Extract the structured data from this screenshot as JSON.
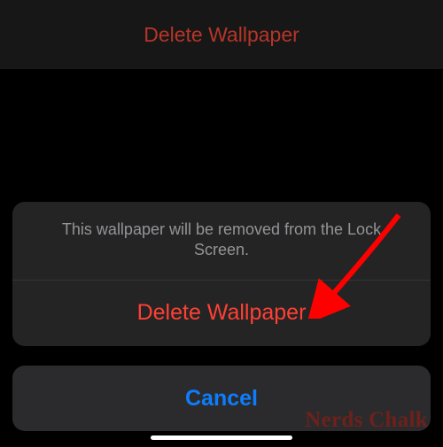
{
  "header": {
    "title": "Delete Wallpaper"
  },
  "actionSheet": {
    "message": "This wallpaper will be removed from the Lock Screen.",
    "destructiveLabel": "Delete Wallpaper",
    "cancelLabel": "Cancel"
  },
  "watermark": {
    "text": "Nerds Chalk"
  },
  "annotation": {
    "arrowColor": "#ff0000"
  }
}
